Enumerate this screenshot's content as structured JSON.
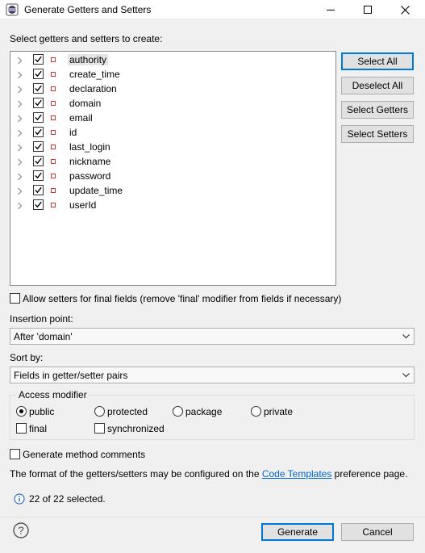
{
  "window": {
    "title": "Generate Getters and Setters",
    "icon": "eclipse-icon"
  },
  "instructions": "Select getters and setters to create:",
  "fields": [
    {
      "name": "authority",
      "checked": true,
      "selected": true
    },
    {
      "name": "create_time",
      "checked": true
    },
    {
      "name": "declaration",
      "checked": true
    },
    {
      "name": "domain",
      "checked": true
    },
    {
      "name": "email",
      "checked": true
    },
    {
      "name": "id",
      "checked": true
    },
    {
      "name": "last_login",
      "checked": true
    },
    {
      "name": "nickname",
      "checked": true
    },
    {
      "name": "password",
      "checked": true
    },
    {
      "name": "update_time",
      "checked": true
    },
    {
      "name": "userId",
      "checked": true
    }
  ],
  "side_buttons": {
    "select_all": "Select All",
    "deselect_all": "Deselect All",
    "select_getters": "Select Getters",
    "select_setters": "Select Setters"
  },
  "allow_final": {
    "label": "Allow setters for final fields (remove 'final' modifier from fields if necessary)",
    "checked": false
  },
  "insertion_point": {
    "label": "Insertion point:",
    "value": "After 'domain'"
  },
  "sort_by": {
    "label": "Sort by:",
    "value": "Fields in getter/setter pairs"
  },
  "access_modifier": {
    "title": "Access modifier",
    "options": [
      "public",
      "protected",
      "package",
      "private"
    ],
    "selected": "public",
    "final_label": "final",
    "synchronized_label": "synchronized"
  },
  "generate_comments": {
    "label": "Generate method comments",
    "checked": false
  },
  "format_note": {
    "before": "The format of the getters/setters may be configured on the ",
    "link": "Code Templates",
    "after": " preference page."
  },
  "status": "22 of 22 selected.",
  "footer": {
    "generate": "Generate",
    "cancel": "Cancel"
  },
  "colors": {
    "accent": "#0078d7",
    "link": "#0066cc",
    "field_icon": "#cc3333"
  }
}
